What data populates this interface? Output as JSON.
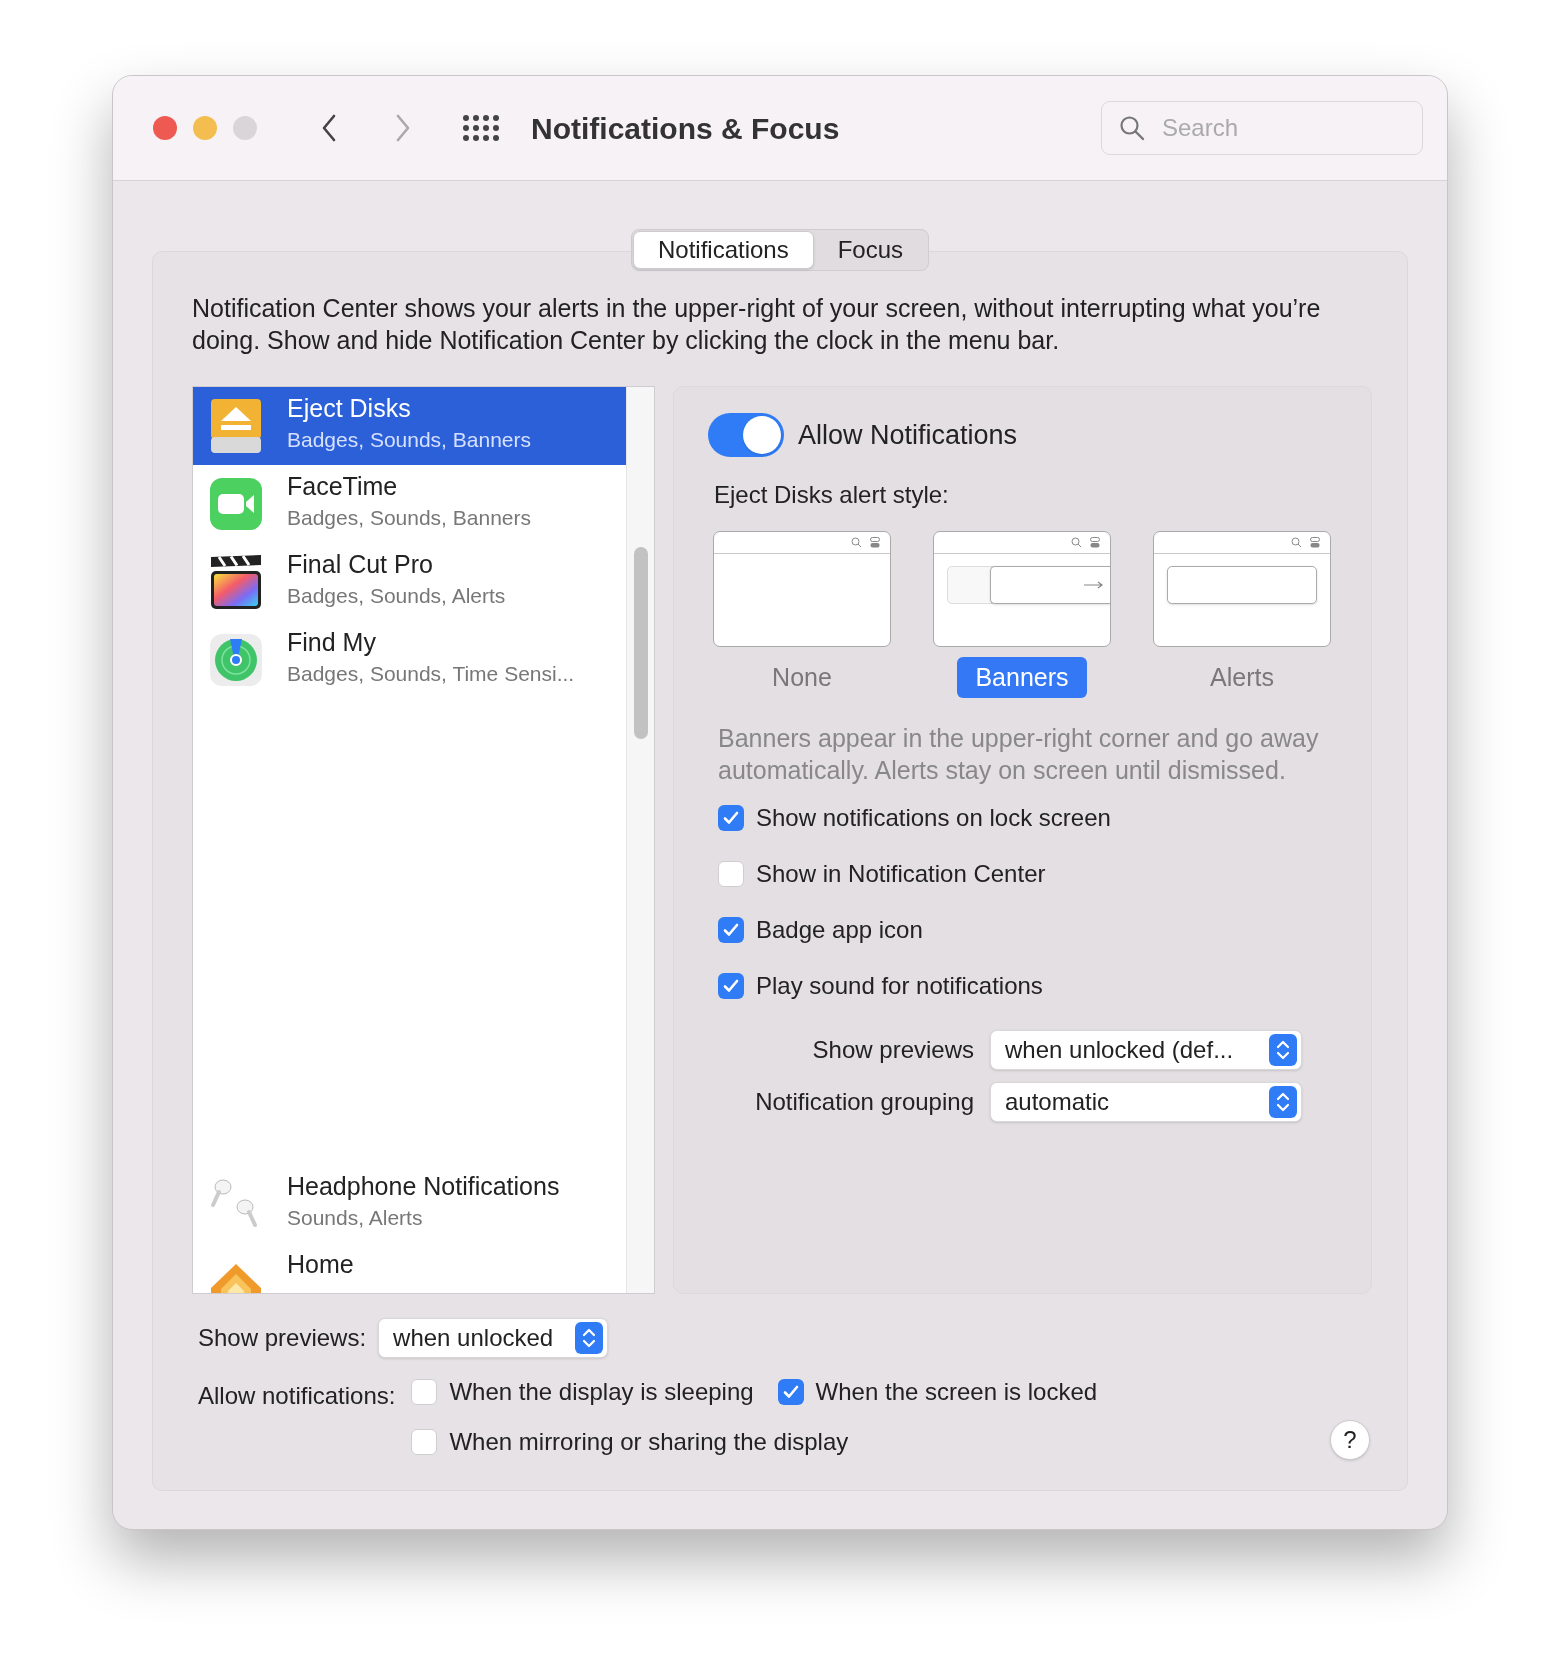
{
  "window": {
    "title": "Notifications & Focus",
    "search": {
      "placeholder": "Search"
    }
  },
  "tabs": [
    {
      "label": "Notifications",
      "selected": true
    },
    {
      "label": "Focus",
      "selected": false
    }
  ],
  "description": "Notification Center shows your alerts in the upper-right of your screen, without interrupting what you’re doing. Show and hide Notification Center by clicking the clock in the menu bar.",
  "apps": [
    {
      "name": "Eject Disks",
      "detail": "Badges, Sounds, Banners",
      "selected": true,
      "kind": "disk"
    },
    {
      "name": "FaceTime",
      "detail": "Badges, Sounds, Banners",
      "selected": false,
      "kind": "camera"
    },
    {
      "name": "Final Cut Pro",
      "detail": "Badges, Sounds, Alerts",
      "selected": false,
      "kind": "clapper"
    },
    {
      "name": "Find My",
      "detail": "Badges, Sounds, Time Sensi...",
      "selected": false,
      "kind": "radar"
    },
    {
      "name": "Headphone Notifications",
      "detail": "Sounds, Alerts",
      "selected": false,
      "kind": "earbuds"
    },
    {
      "name": "Home",
      "selected": false,
      "kind": "house"
    }
  ],
  "settings": {
    "allow": {
      "label": "Allow Notifications",
      "on": true
    },
    "style_heading": "Eject Disks alert style:",
    "styles": [
      {
        "label": "None",
        "selected": false,
        "kind": "none"
      },
      {
        "label": "Banners",
        "selected": true,
        "kind": "banner"
      },
      {
        "label": "Alerts",
        "selected": false,
        "kind": "alert"
      }
    ],
    "explanation": "Banners appear in the upper-right corner and go away automatically. Alerts stay on screen until dismissed.",
    "checkboxes": [
      {
        "label": "Show notifications on lock screen",
        "checked": true
      },
      {
        "label": "Show in Notification Center",
        "checked": false
      },
      {
        "label": "Badge app icon",
        "checked": true
      },
      {
        "label": "Play sound for notifications",
        "checked": true
      }
    ],
    "selects": [
      {
        "label": "Show previews",
        "value": "when unlocked (def..."
      },
      {
        "label": "Notification grouping",
        "value": "automatic"
      }
    ]
  },
  "footer": {
    "previews": {
      "label": "Show previews:",
      "value": "when unlocked"
    },
    "allow_label": "Allow notifications:",
    "options": [
      {
        "label": "When the display is sleeping",
        "checked": false
      },
      {
        "label": "When the screen is locked",
        "checked": true
      },
      {
        "label": "When mirroring or sharing the display",
        "checked": false
      }
    ],
    "help": "?"
  }
}
